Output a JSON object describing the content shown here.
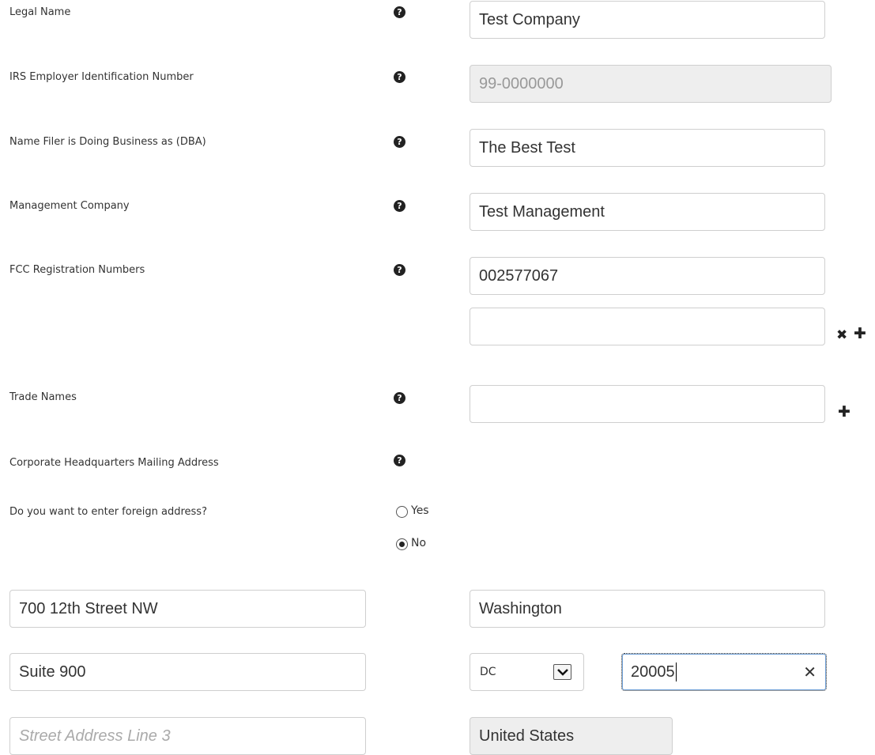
{
  "labels": {
    "legal_name": "Legal Name",
    "irs_ein": "IRS Employer Identification Number",
    "dba": "Name Filer is Doing Business as (DBA)",
    "management_company": "Management Company",
    "fcc_registration": "FCC Registration Numbers",
    "trade_names": "Trade Names",
    "hq_mailing_address": "Corporate Headquarters Mailing Address",
    "foreign_address_question": "Do you want to enter foreign address?"
  },
  "help_icon_glyph": "?",
  "fields": {
    "legal_name": "Test Company",
    "irs_ein": "99-0000000",
    "dba": "The Best Test",
    "management_company": "Test Management",
    "fcc_registration_1": "002577067",
    "fcc_registration_2": "",
    "trade_name_1": ""
  },
  "foreign_address": {
    "options": [
      {
        "label": "Yes",
        "checked": false
      },
      {
        "label": "No",
        "checked": true
      }
    ]
  },
  "address": {
    "street_line_1": "700 12th Street NW",
    "street_line_2": "Suite 900",
    "street_line_3_placeholder": "Street Address Line 3",
    "city": "Washington",
    "state": "DC",
    "zip": "20005",
    "country": "United States"
  },
  "icons": {
    "remove": "✖",
    "add": "✚",
    "clear": "✕"
  }
}
